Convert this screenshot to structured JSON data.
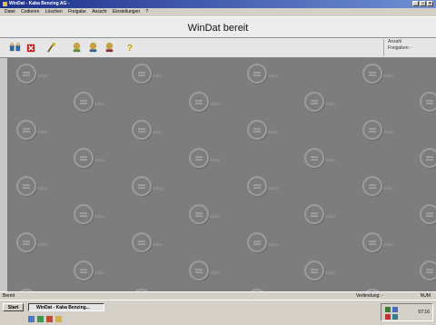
{
  "window": {
    "title": "WinDat - Kaba Benzing AG -",
    "controls": [
      "_",
      "□",
      "×"
    ]
  },
  "menu": [
    "Datei",
    "Codieren",
    "Löschen",
    "Freigabe",
    "Ansicht",
    "Einstellungen",
    "?"
  ],
  "header": {
    "title": "WinDat bereit"
  },
  "info": {
    "line1": "Anzahl",
    "line2": "Freigaben: -"
  },
  "watermark_text": "kaba",
  "status": {
    "left": "Bereit",
    "mid": "Verbindung: -",
    "right": "NUM"
  },
  "taskbar": {
    "start": "Start",
    "task": "WinDat - Kaba Benzing...",
    "clock": "07:16"
  },
  "colors": {
    "titlebar": "#1c2f8c",
    "canvas": "#7d7d7d",
    "chrome": "#d4d0c8"
  }
}
